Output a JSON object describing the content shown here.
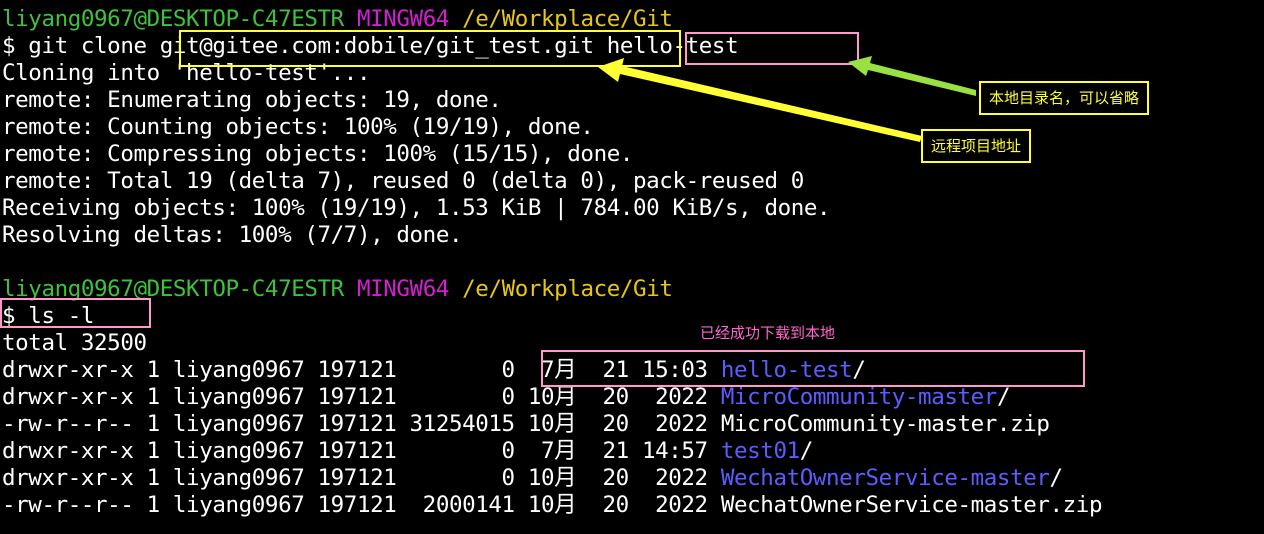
{
  "terminal": {
    "prompt1": {
      "user": "liyang0967@DESKTOP-C47ESTR",
      "env": "MINGW64",
      "path": "/e/Workplace/Git"
    },
    "cmd1": {
      "prefix": "$ git clone ",
      "repo": "git@gitee.com:dobile/git_test.git",
      "target": "hello-test"
    },
    "output1": [
      "Cloning into 'hello-test'...",
      "remote: Enumerating objects: 19, done.",
      "remote: Counting objects: 100% (19/19), done.",
      "remote: Compressing objects: 100% (15/15), done.",
      "remote: Total 19 (delta 7), reused 0 (delta 0), pack-reused 0",
      "Receiving objects: 100% (19/19), 1.53 KiB | 784.00 KiB/s, done.",
      "Resolving deltas: 100% (7/7), done."
    ],
    "prompt2": {
      "user": "liyang0967@DESKTOP-C47ESTR",
      "env": "MINGW64",
      "path": "/e/Workplace/Git"
    },
    "cmd2": "$ ls -l",
    "total": "total 32500",
    "listing": [
      {
        "meta": "drwxr-xr-x 1 liyang0967 197121        0  7月  21 15:03 ",
        "name": "hello-test",
        "suffix": "/",
        "is_dir": true
      },
      {
        "meta": "drwxr-xr-x 1 liyang0967 197121        0 10月  20  2022 ",
        "name": "MicroCommunity-master",
        "suffix": "/",
        "is_dir": true
      },
      {
        "meta": "-rw-r--r-- 1 liyang0967 197121 31254015 10月  20  2022 ",
        "name": "MicroCommunity-master.zip",
        "suffix": "",
        "is_dir": false
      },
      {
        "meta": "drwxr-xr-x 1 liyang0967 197121        0  7月  21 14:57 ",
        "name": "test01",
        "suffix": "/",
        "is_dir": true
      },
      {
        "meta": "drwxr-xr-x 1 liyang0967 197121        0 10月  20  2022 ",
        "name": "WechatOwnerService-master",
        "suffix": "/",
        "is_dir": true
      },
      {
        "meta": "-rw-r--r-- 1 liyang0967 197121  2000141 10月  20  2022 ",
        "name": "WechatOwnerService-master.zip",
        "suffix": "",
        "is_dir": false
      }
    ]
  },
  "annotations": {
    "local_dir_label": "本地目录名，可以省略",
    "remote_addr_label": "远程项目地址",
    "download_note": "已经成功下载到本地"
  },
  "colors": {
    "background": "#000000",
    "prompt_user": "#3ec23e",
    "prompt_env": "#d21fcf",
    "prompt_path": "#e6c619",
    "directory": "#5c5cff",
    "highlight_yellow": "#ffff33",
    "highlight_pink": "#ff99cc",
    "arrow_green": "#99e040"
  }
}
